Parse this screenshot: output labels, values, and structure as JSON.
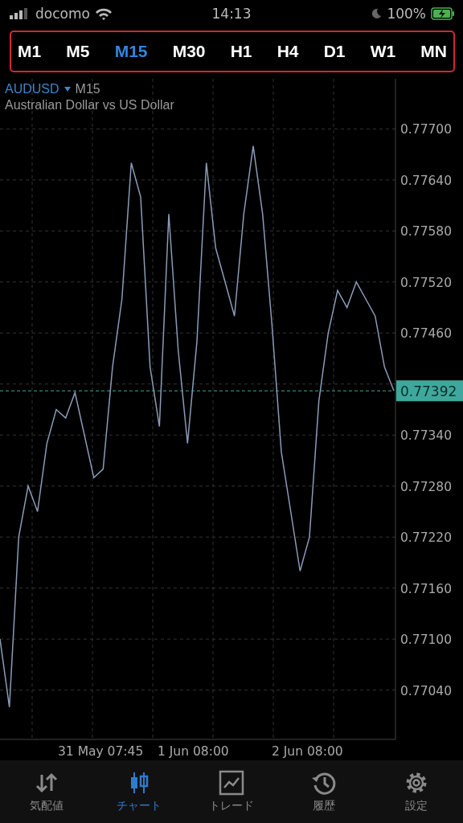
{
  "status_bar": {
    "carrier": "docomo",
    "time": "14:13",
    "battery": "100%"
  },
  "timeframes": [
    {
      "label": "M1",
      "selected": false
    },
    {
      "label": "M5",
      "selected": false
    },
    {
      "label": "M15",
      "selected": true
    },
    {
      "label": "M30",
      "selected": false
    },
    {
      "label": "H1",
      "selected": false
    },
    {
      "label": "H4",
      "selected": false
    },
    {
      "label": "D1",
      "selected": false
    },
    {
      "label": "W1",
      "selected": false
    },
    {
      "label": "MN",
      "selected": false
    }
  ],
  "symbol": {
    "name": "AUDUSD",
    "timeframe": "M15",
    "description": "Australian Dollar vs US Dollar"
  },
  "chart": {
    "current_price": "0.77392",
    "time_labels": [
      "31 May 07:45",
      "1 Jun 08:00",
      "2 Jun 08:00"
    ],
    "chart_data": {
      "type": "line",
      "grid": true,
      "ylim": [
        0.76982,
        0.77759
      ],
      "yticks": [
        {
          "value": 0.777,
          "label": "0.77700"
        },
        {
          "value": 0.7764,
          "label": "0.77640"
        },
        {
          "value": 0.7758,
          "label": "0.77580"
        },
        {
          "value": 0.7752,
          "label": "0.77520"
        },
        {
          "value": 0.7746,
          "label": "0.77460"
        },
        {
          "value": 0.7734,
          "label": "0.77340"
        },
        {
          "value": 0.7728,
          "label": "0.77280"
        },
        {
          "value": 0.7722,
          "label": "0.77220"
        },
        {
          "value": 0.7716,
          "label": "0.77160"
        },
        {
          "value": 0.771,
          "label": "0.77100"
        },
        {
          "value": 0.7704,
          "label": "0.77040"
        }
      ],
      "series": [
        {
          "color": "#8a9bb8",
          "line_style": "solid",
          "values": [
            0.771,
            0.7702,
            0.7722,
            0.7728,
            0.7725,
            0.7733,
            0.7737,
            0.7736,
            0.7739,
            0.7734,
            0.7729,
            0.773,
            0.7742,
            0.775,
            0.7766,
            0.7762,
            0.7742,
            0.7735,
            0.776,
            0.7744,
            0.7733,
            0.7745,
            0.7766,
            0.7756,
            0.7752,
            0.7748,
            0.776,
            0.7768,
            0.776,
            0.7747,
            0.7732,
            0.7725,
            0.7718,
            0.7722,
            0.7738,
            0.7746,
            0.7751,
            0.7749,
            0.7752,
            0.775,
            0.7748,
            0.7742,
            0.77392
          ]
        },
        {
          "color": "#3fa89c",
          "line_style": "dashed",
          "values": [
            0.77392,
            0.77392,
            0.77392,
            0.77392,
            0.77392,
            0.77392,
            0.77392,
            0.77392,
            0.77392,
            0.77392,
            0.77392,
            0.77392,
            0.77392,
            0.77392,
            0.77392,
            0.77392,
            0.77392,
            0.77392,
            0.77392,
            0.77392,
            0.77392,
            0.77392,
            0.77392,
            0.77392,
            0.77392,
            0.77392,
            0.77392,
            0.77392,
            0.77392,
            0.77392,
            0.77392,
            0.77392,
            0.77392,
            0.77392,
            0.77392,
            0.77392,
            0.77392,
            0.77392,
            0.77392,
            0.77392,
            0.77392,
            0.77392,
            0.77392
          ]
        }
      ]
    }
  },
  "nav": [
    {
      "label": "気配値",
      "selected": false
    },
    {
      "label": "チャート",
      "selected": true
    },
    {
      "label": "トレード",
      "selected": false
    },
    {
      "label": "履歴",
      "selected": false
    },
    {
      "label": "設定",
      "selected": false
    }
  ]
}
